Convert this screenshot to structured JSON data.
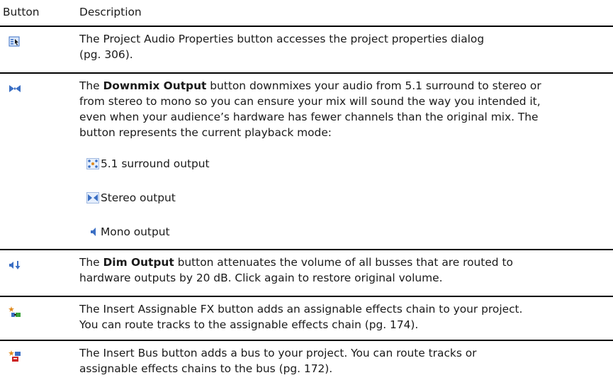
{
  "header": {
    "button": "Button",
    "description": "Description"
  },
  "rows": [
    {
      "icon": "project-audio-properties-icon",
      "pre": "The ",
      "name": "Project Audio Properties",
      "post": " button accesses the project properties dialog",
      "line2": "(pg. 306)."
    },
    {
      "icon": "downmix-output-icon",
      "pre": "The ",
      "name": "Downmix Output",
      "post": " button downmixes your audio from 5.1 surround to stereo or",
      "line2": "from stereo to mono so you can ensure your mix will sound the way you intended it,",
      "line3": "even when your audience’s hardware has fewer channels than the original mix. The",
      "line4": "button represents the current playback mode:",
      "modes": [
        {
          "icon": "surround-output-icon",
          "label": "5.1 surround output"
        },
        {
          "icon": "stereo-output-icon",
          "label": "Stereo output"
        },
        {
          "icon": "mono-output-icon",
          "label": "Mono output"
        }
      ]
    },
    {
      "icon": "dim-output-icon",
      "pre": "The ",
      "name": "Dim Output",
      "post": " button attenuates the volume of all busses that are routed to",
      "line2": "hardware outputs by 20 dB. Click again to restore original volume."
    },
    {
      "icon": "insert-assignable-fx-icon",
      "pre": "The ",
      "name": "Insert Assignable FX",
      "post": " button adds an assignable effects chain to your project.",
      "line2": "You can route tracks to the assignable effects chain (pg. 174)."
    },
    {
      "icon": "insert-bus-icon",
      "pre": "The ",
      "name": "Insert Bus",
      "post": " button adds a bus to your project. You can route tracks or",
      "line2": "assignable effects chains to the bus (pg. 172)."
    }
  ],
  "colors": {
    "rule": "#000000",
    "icon_blue": "#3b6fc4",
    "icon_orange": "#e08a1e",
    "icon_red": "#cc2222",
    "icon_green": "#3aa23a"
  }
}
